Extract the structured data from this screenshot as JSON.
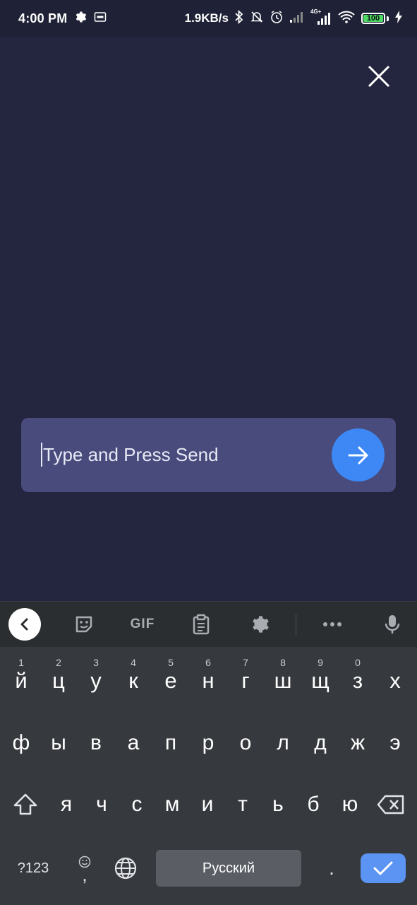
{
  "status_bar": {
    "time": "4:00 PM",
    "speed": "1.9KB/s",
    "network": "4G+",
    "battery": "100"
  },
  "chat": {
    "input_placeholder": "Type and Press Send"
  },
  "keyboard": {
    "toolbar": {
      "gif_label": "GIF"
    },
    "row1": [
      {
        "key": "й",
        "hint": "1"
      },
      {
        "key": "ц",
        "hint": "2"
      },
      {
        "key": "у",
        "hint": "3"
      },
      {
        "key": "к",
        "hint": "4"
      },
      {
        "key": "е",
        "hint": "5"
      },
      {
        "key": "н",
        "hint": "6"
      },
      {
        "key": "г",
        "hint": "7"
      },
      {
        "key": "ш",
        "hint": "8"
      },
      {
        "key": "щ",
        "hint": "9"
      },
      {
        "key": "з",
        "hint": "0"
      },
      {
        "key": "х",
        "hint": ""
      }
    ],
    "row2": [
      "ф",
      "ы",
      "в",
      "а",
      "п",
      "р",
      "о",
      "л",
      "д",
      "ж",
      "э"
    ],
    "row3": [
      "я",
      "ч",
      "с",
      "м",
      "и",
      "т",
      "ь",
      "б",
      "ю"
    ],
    "symbols_label": "?123",
    "comma_label": ",",
    "space_label": "Русский",
    "period_label": "."
  },
  "colors": {
    "background": "#24263f",
    "input_bar": "#484b7b",
    "send_button": "#3d88f5",
    "keyboard": "#36393d",
    "enter_key": "#5b94f2"
  }
}
